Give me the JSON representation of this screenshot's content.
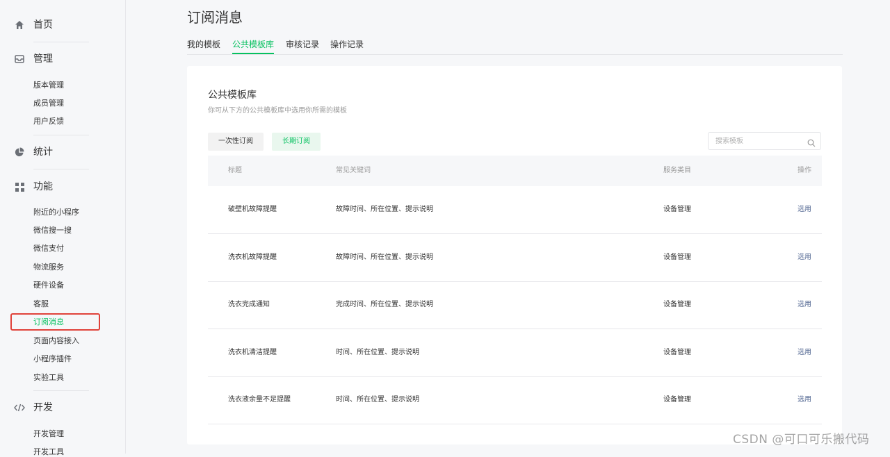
{
  "sidebar": {
    "groups": [
      {
        "label": "首页",
        "icon": "home-icon",
        "items": []
      },
      {
        "label": "管理",
        "icon": "inbox-icon",
        "items": [
          "版本管理",
          "成员管理",
          "用户反馈"
        ]
      },
      {
        "label": "统计",
        "icon": "pie-chart-icon",
        "items": []
      },
      {
        "label": "功能",
        "icon": "grid-icon",
        "items": [
          "附近的小程序",
          "微信搜一搜",
          "微信支付",
          "物流服务",
          "硬件设备",
          "客服",
          "订阅消息",
          "页面内容接入",
          "小程序插件",
          "实验工具"
        ]
      },
      {
        "label": "开发",
        "icon": "code-icon",
        "items": [
          "开发管理",
          "开发工具"
        ]
      }
    ],
    "active_item": "订阅消息"
  },
  "page": {
    "title": "订阅消息"
  },
  "tabs": [
    {
      "label": "我的模板",
      "active": false
    },
    {
      "label": "公共模板库",
      "active": true
    },
    {
      "label": "审核记录",
      "active": false
    },
    {
      "label": "操作记录",
      "active": false
    }
  ],
  "card": {
    "title": "公共模板库",
    "subtitle": "你可从下方的公共模板库中选用你所需的模板",
    "buttons": {
      "one_time": "一次性订阅",
      "long_term": "长期订阅"
    },
    "search": {
      "placeholder": "搜索模板",
      "value": ""
    }
  },
  "table": {
    "columns": [
      "标题",
      "常见关键词",
      "服务类目",
      "操作"
    ],
    "rows": [
      {
        "title": "破壁机故障提醒",
        "keywords": "故障时间、所在位置、提示说明",
        "category": "设备管理",
        "action": "选用"
      },
      {
        "title": "洗衣机故障提醒",
        "keywords": "故障时间、所在位置、提示说明",
        "category": "设备管理",
        "action": "选用"
      },
      {
        "title": "洗衣完成通知",
        "keywords": "完成时间、所在位置、提示说明",
        "category": "设备管理",
        "action": "选用"
      },
      {
        "title": "洗衣机清洁提醒",
        "keywords": "时间、所在位置、提示说明",
        "category": "设备管理",
        "action": "选用"
      },
      {
        "title": "洗衣液余量不足提醒",
        "keywords": "时间、所在位置、提示说明",
        "category": "设备管理",
        "action": "选用"
      }
    ]
  },
  "watermark": "CSDN @可口可乐搬代码",
  "colors": {
    "accent": "#07c160",
    "link": "#576b95",
    "highlight": "#e0423a"
  }
}
